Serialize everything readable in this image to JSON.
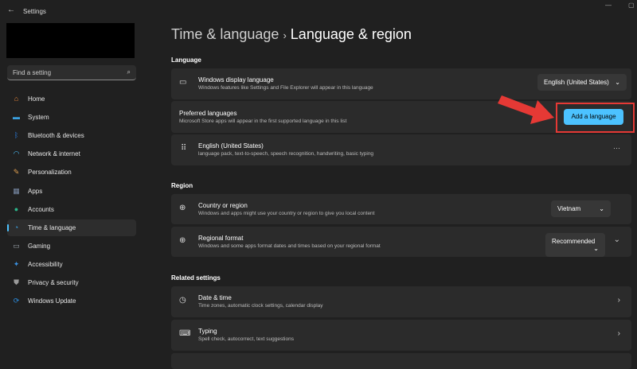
{
  "window": {
    "title": "Settings"
  },
  "sidebar": {
    "search_placeholder": "Find a setting",
    "items": [
      {
        "label": "Home",
        "color": "#e8863a"
      },
      {
        "label": "System",
        "color": "#3aa0e0"
      },
      {
        "label": "Bluetooth & devices",
        "color": "#2b7de0"
      },
      {
        "label": "Network & internet",
        "color": "#4cc2ff"
      },
      {
        "label": "Personalization",
        "color": "#e0a050"
      },
      {
        "label": "Apps",
        "color": "#7a8ca8"
      },
      {
        "label": "Accounts",
        "color": "#2bb58a"
      },
      {
        "label": "Time & language",
        "color": "#3aa0e0"
      },
      {
        "label": "Gaming",
        "color": "#9aa0a8"
      },
      {
        "label": "Accessibility",
        "color": "#3a90e0"
      },
      {
        "label": "Privacy & security",
        "color": "#9a9a9a"
      },
      {
        "label": "Windows Update",
        "color": "#2b8ee0"
      }
    ],
    "selected": "Time & language"
  },
  "header": {
    "parent": "Time & language",
    "separator": "›",
    "title": "Language & region"
  },
  "language": {
    "section": "Language",
    "display": {
      "title": "Windows display language",
      "subtitle": "Windows features like Settings and File Explorer will appear in this language",
      "value": "English (United States)"
    },
    "preferred": {
      "title": "Preferred languages",
      "subtitle": "Microsoft Store apps will appear in the first supported language in this list",
      "button": "Add a language"
    },
    "item": {
      "title": "English (United States)",
      "subtitle": "language pack, text-to-speech, speech recognition, handwriting, basic typing",
      "more": "···"
    }
  },
  "region": {
    "section": "Region",
    "country": {
      "title": "Country or region",
      "subtitle": "Windows and apps might use your country or region to give you local content",
      "value": "Vietnam"
    },
    "format": {
      "title": "Regional format",
      "subtitle": "Windows and some apps format dates and times based on your regional format",
      "value": "Recommended"
    }
  },
  "related": {
    "section": "Related settings",
    "items": [
      {
        "title": "Date & time",
        "subtitle": "Time zones, automatic clock settings, calendar display"
      },
      {
        "title": "Typing",
        "subtitle": "Spell check, autocorrect, text suggestions"
      }
    ]
  },
  "colors": {
    "accent": "#4cc2ff",
    "annotation": "#e53935"
  }
}
